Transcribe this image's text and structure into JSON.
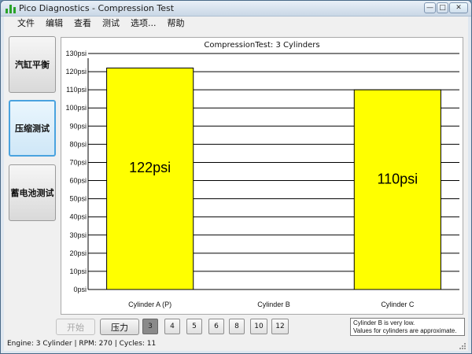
{
  "window": {
    "title": "Pico Diagnostics - Compression Test",
    "controls": {
      "minimize": "—",
      "maximize": "□",
      "close": "✕"
    }
  },
  "menu": [
    "文件",
    "编辑",
    "查看",
    "测试",
    "选项...",
    "帮助"
  ],
  "nav": [
    {
      "label": "汽缸平衡",
      "active": false
    },
    {
      "label": "压缩测试",
      "active": true
    },
    {
      "label": "蓄电池测试",
      "active": false
    }
  ],
  "chart_data": {
    "type": "bar",
    "title": "CompressionTest: 3 Cylinders",
    "categories": [
      "Cylinder A (P)",
      "Cylinder B",
      "Cylinder C"
    ],
    "values": [
      122,
      0,
      110
    ],
    "value_labels": [
      "122psi",
      "",
      "110psi"
    ],
    "yticks": [
      "0psi",
      "10psi",
      "20psi",
      "30psi",
      "40psi",
      "50psi",
      "60psi",
      "70psi",
      "80psi",
      "90psi",
      "100psi",
      "110psi",
      "120psi",
      "130psi"
    ],
    "ylim": [
      0,
      130
    ],
    "bar_color": "#ffff00",
    "grid": true
  },
  "controls": {
    "start": "开始",
    "pressure": "压力",
    "cylinder_counts": [
      "3",
      "4",
      "5",
      "6",
      "8",
      "10",
      "12"
    ],
    "selected_count": "3"
  },
  "message": {
    "line1": "Cylinder B is very low.",
    "line2": "Values for cylinders are approximate."
  },
  "status": "Engine:  3 Cylinder | RPM: 270 | Cycles: 11"
}
